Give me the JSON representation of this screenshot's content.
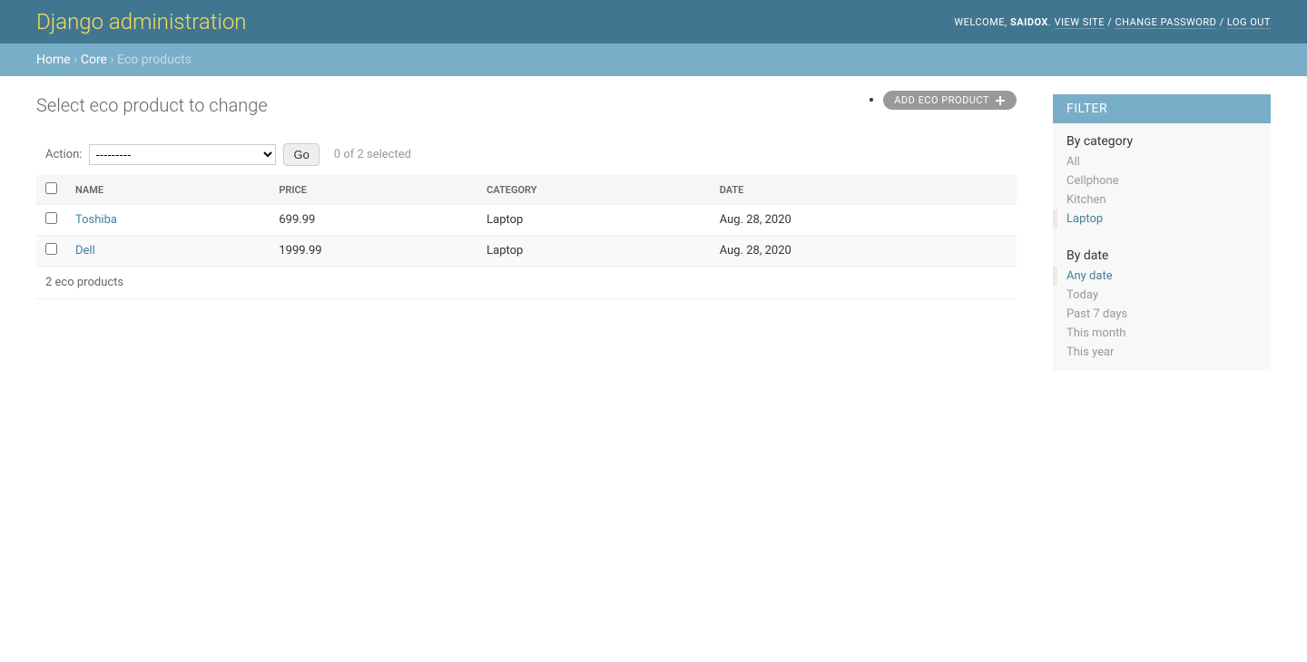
{
  "header": {
    "site_title": "Django administration",
    "welcome": "WELCOME, ",
    "username": "SAIDOX",
    "view_site": "VIEW SITE",
    "change_password": "CHANGE PASSWORD",
    "logout": "LOG OUT",
    "sep_dot": ". ",
    "sep_slash": " / "
  },
  "breadcrumbs": {
    "home": "Home",
    "app": "Core",
    "model": "Eco products",
    "sep": " › "
  },
  "page": {
    "title": "Select eco product to change",
    "add_button": "ADD ECO PRODUCT"
  },
  "actions": {
    "label": "Action:",
    "placeholder": "---------",
    "go": "Go",
    "counter": "0 of 2 selected"
  },
  "table": {
    "headers": [
      "NAME",
      "PRICE",
      "CATEGORY",
      "DATE"
    ],
    "rows": [
      {
        "name": "Toshiba",
        "price": "699.99",
        "category": "Laptop",
        "date": "Aug. 28, 2020"
      },
      {
        "name": "Dell",
        "price": "1999.99",
        "category": "Laptop",
        "date": "Aug. 28, 2020"
      }
    ],
    "paginator": "2 eco products"
  },
  "filter": {
    "title": "FILTER",
    "sections": [
      {
        "title": "By category",
        "items": [
          {
            "label": "All",
            "selected": false
          },
          {
            "label": "Cellphone",
            "selected": false
          },
          {
            "label": "Kitchen",
            "selected": false
          },
          {
            "label": "Laptop",
            "selected": true
          }
        ]
      },
      {
        "title": "By date",
        "items": [
          {
            "label": "Any date",
            "selected": true
          },
          {
            "label": "Today",
            "selected": false
          },
          {
            "label": "Past 7 days",
            "selected": false
          },
          {
            "label": "This month",
            "selected": false
          },
          {
            "label": "This year",
            "selected": false
          }
        ]
      }
    ]
  }
}
